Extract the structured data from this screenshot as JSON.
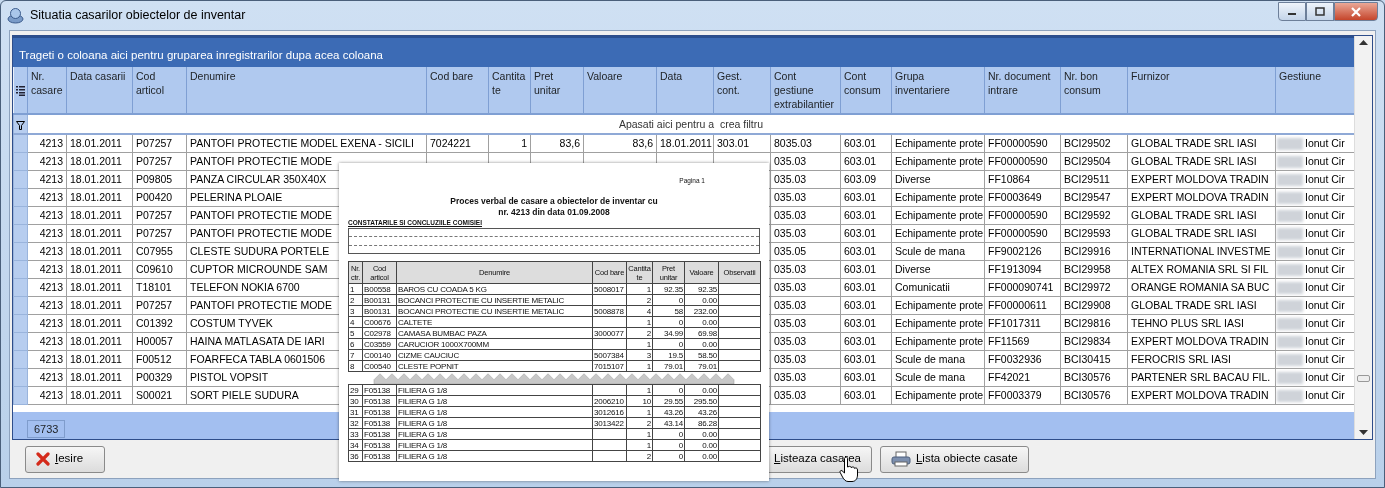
{
  "window": {
    "title": "Situatia casarilor obiectelor de inventar"
  },
  "grid": {
    "group_panel": "Trageti o coloana aici pentru gruparea inregistrarilor dupa acea coloana",
    "columns": [
      "Nr. casare",
      "Data casarii",
      "Cod articol",
      "Denumire",
      "Cod bare",
      "Cantitate",
      "Pret unitar",
      "Valoare",
      "Data",
      "Gest. cont.",
      "Cont gestiune extrabilantier",
      "Cont consum",
      "Grupa inventariere",
      "Nr. document intrare",
      "Nr. bon consum",
      "Furnizor",
      "Gestiune"
    ],
    "filter_row": "Apasati aici pentru a  crea filtru",
    "rows": [
      {
        "nr_casare": "4213",
        "data_casarii": "18.01.2011",
        "cod_articol": "P07257",
        "denumire": "PANTOFI PROTECTIE MODEL EXENA - SICILI",
        "cod_bare": "7024221",
        "cantitate": "1",
        "pret_unitar": "83,6",
        "valoare": "83,6",
        "data": "18.01.2011",
        "gest_cont": "303.01",
        "cont_gestiune": "8035.03",
        "cont_consum": "603.01",
        "grupa_inventariere": "Echipamente prote",
        "nr_document_intrare": "FF00000590",
        "nr_bon_consum": "BCI29502",
        "furnizor": "GLOBAL TRADE SRL IASI",
        "gestiune": "Ionut Cir"
      },
      {
        "nr_casare": "4213",
        "data_casarii": "18.01.2011",
        "cod_articol": "P07257",
        "denumire": "PANTOFI PROTECTIE MODE",
        "cont_gestiune": "035.03",
        "cont_consum": "603.01",
        "grupa_inventariere": "Echipamente prote",
        "nr_document_intrare": "FF00000590",
        "nr_bon_consum": "BCI29504",
        "furnizor": "GLOBAL TRADE SRL IASI",
        "gestiune": "Ionut Cir"
      },
      {
        "nr_casare": "4213",
        "data_casarii": "18.01.2011",
        "cod_articol": "P09805",
        "denumire": "PANZA CIRCULAR 350X40X",
        "cont_gestiune": "035.03",
        "cont_consum": "603.09",
        "grupa_inventariere": "Diverse",
        "nr_document_intrare": "FF10864",
        "nr_bon_consum": "BCI29511",
        "furnizor": "EXPERT MOLDOVA TRADIN",
        "gestiune": "Ionut Cir"
      },
      {
        "nr_casare": "4213",
        "data_casarii": "18.01.2011",
        "cod_articol": "P00420",
        "denumire": "PELERINA PLOAIE",
        "cont_gestiune": "035.03",
        "cont_consum": "603.01",
        "grupa_inventariere": "Echipamente prote",
        "nr_document_intrare": "FF0003649",
        "nr_bon_consum": "BCI29547",
        "furnizor": "EXPERT MOLDOVA TRADIN",
        "gestiune": "Ionut Cir"
      },
      {
        "nr_casare": "4213",
        "data_casarii": "18.01.2011",
        "cod_articol": "P07257",
        "denumire": "PANTOFI PROTECTIE MODE",
        "cont_gestiune": "035.03",
        "cont_consum": "603.01",
        "grupa_inventariere": "Echipamente prote",
        "nr_document_intrare": "FF00000590",
        "nr_bon_consum": "BCI29592",
        "furnizor": "GLOBAL TRADE SRL IASI",
        "gestiune": "Ionut Cir"
      },
      {
        "nr_casare": "4213",
        "data_casarii": "18.01.2011",
        "cod_articol": "P07257",
        "denumire": "PANTOFI PROTECTIE MODE",
        "cont_gestiune": "035.03",
        "cont_consum": "603.01",
        "grupa_inventariere": "Echipamente prote",
        "nr_document_intrare": "FF00000590",
        "nr_bon_consum": "BCI29593",
        "furnizor": "GLOBAL TRADE SRL IASI",
        "gestiune": "Ionut Cir"
      },
      {
        "nr_casare": "4213",
        "data_casarii": "18.01.2011",
        "cod_articol": "C07955",
        "denumire": "CLESTE SUDURA PORTELE",
        "cont_gestiune": "035.05",
        "cont_consum": "603.01",
        "grupa_inventariere": "Scule de mana",
        "nr_document_intrare": "FF9002126",
        "nr_bon_consum": "BCI29916",
        "furnizor": "INTERNATIONAL INVESTME",
        "gestiune": "Ionut Cir"
      },
      {
        "nr_casare": "4213",
        "data_casarii": "18.01.2011",
        "cod_articol": "C09610",
        "denumire": "CUPTOR MICROUNDE SAM",
        "cont_gestiune": "035.03",
        "cont_consum": "603.01",
        "grupa_inventariere": "Diverse",
        "nr_document_intrare": "FF1913094",
        "nr_bon_consum": "BCI29958",
        "furnizor": "ALTEX ROMANIA SRL SI FIL",
        "gestiune": "Ionut Cir"
      },
      {
        "nr_casare": "4213",
        "data_casarii": "18.01.2011",
        "cod_articol": "T18101",
        "denumire": "TELEFON NOKIA 6700",
        "cont_gestiune": "035.03",
        "cont_consum": "603.01",
        "grupa_inventariere": "Comunicatii",
        "nr_document_intrare": "FF000090741",
        "nr_bon_consum": "BCI29972",
        "furnizor": "ORANGE ROMANIA SA BUC",
        "gestiune": "Ionut Cir"
      },
      {
        "nr_casare": "4213",
        "data_casarii": "18.01.2011",
        "cod_articol": "P07257",
        "denumire": "PANTOFI PROTECTIE MODE",
        "cont_gestiune": "035.03",
        "cont_consum": "603.01",
        "grupa_inventariere": "Echipamente prote",
        "nr_document_intrare": "FF00000611",
        "nr_bon_consum": "BCI29908",
        "furnizor": "GLOBAL TRADE SRL IASI",
        "gestiune": "Ionut Cir"
      },
      {
        "nr_casare": "4213",
        "data_casarii": "18.01.2011",
        "cod_articol": "C01392",
        "denumire": "COSTUM TYVEK",
        "cont_gestiune": "035.03",
        "cont_consum": "603.01",
        "grupa_inventariere": "Echipamente prote",
        "nr_document_intrare": "FF1017311",
        "nr_bon_consum": "BCI29816",
        "furnizor": "TEHNO PLUS SRL IASI",
        "gestiune": "Ionut Cir"
      },
      {
        "nr_casare": "4213",
        "data_casarii": "18.01.2011",
        "cod_articol": "H00057",
        "denumire": "HAINA MATLASATA DE IARI",
        "cont_gestiune": "035.03",
        "cont_consum": "603.01",
        "grupa_inventariere": "Echipamente prote",
        "nr_document_intrare": "FF11569",
        "nr_bon_consum": "BCI29834",
        "furnizor": "EXPERT MOLDOVA TRADIN",
        "gestiune": "Ionut Cir"
      },
      {
        "nr_casare": "4213",
        "data_casarii": "18.01.2011",
        "cod_articol": "F00512",
        "denumire": "FOARFECA TABLA  0601506",
        "cont_gestiune": "035.03",
        "cont_consum": "603.01",
        "grupa_inventariere": "Scule de mana",
        "nr_document_intrare": "FF0032936",
        "nr_bon_consum": "BCI30415",
        "furnizor": "FEROCRIS SRL IASI",
        "gestiune": "Ionut Cir"
      },
      {
        "nr_casare": "4213",
        "data_casarii": "18.01.2011",
        "cod_articol": "P00329",
        "denumire": "PISTOL VOPSIT",
        "cont_gestiune": "035.03",
        "cont_consum": "603.01",
        "grupa_inventariere": "Scule de mana",
        "nr_document_intrare": "FF42021",
        "nr_bon_consum": "BCI30576",
        "furnizor": "PARTENER SRL BACAU FIL.",
        "gestiune": "Ionut Cir"
      },
      {
        "nr_casare": "4213",
        "data_casarii": "18.01.2011",
        "cod_articol": "S00021",
        "denumire": "SORT PIELE SUDURA",
        "cont_gestiune": "035.03",
        "cont_consum": "603.01",
        "grupa_inventariere": "Echipamente prote",
        "nr_document_intrare": "FF0003379",
        "nr_bon_consum": "BCI30576",
        "furnizor": "EXPERT MOLDOVA TRADIN",
        "gestiune": "Ionut Cir"
      }
    ],
    "footer_count": "6733"
  },
  "report": {
    "page": "Pagina 1",
    "title_lines": [
      "Proces verbal de casare a obiectelor de inventar cu",
      "nr. 4213 din data 01.09.2008"
    ],
    "section": "CONSTATARILE SI CONCLUZIILE COMISIEI",
    "columns": [
      "Nr. ctr.",
      "Cod articol",
      "Denumire",
      "Cod bare",
      "Cantitate",
      "Pret unitar",
      "Valoare",
      "Observatii"
    ],
    "rows_before_tear": [
      {
        "nr": "1",
        "cod_articol": "B00558",
        "denumire": "BAROS CU COADA 5 KG",
        "cod_bare": "5008017",
        "cantitate": "1",
        "pret_unitar": "92.35",
        "valoare": "92.35"
      },
      {
        "nr": "2",
        "cod_articol": "B00131",
        "denumire": "BOCANCI PROTECTIE CU INSERTIE METALIC",
        "cantitate": "2",
        "pret_unitar": "0",
        "valoare": "0.00"
      },
      {
        "nr": "3",
        "cod_articol": "B00131",
        "denumire": "BOCANCI PROTECTIE CU INSERTIE METALIC",
        "cod_bare": "5008878",
        "cantitate": "4",
        "pret_unitar": "58",
        "valoare": "232.00"
      },
      {
        "nr": "4",
        "cod_articol": "C00676",
        "denumire": "CALTETE",
        "cantitate": "1",
        "pret_unitar": "0",
        "valoare": "0.00"
      },
      {
        "nr": "5",
        "cod_articol": "C02978",
        "denumire": "CAMASA BUMBAC PAZA",
        "cod_bare": "3000077",
        "cantitate": "2",
        "pret_unitar": "34.99",
        "valoare": "69.98"
      },
      {
        "nr": "6",
        "cod_articol": "C03559",
        "denumire": "CARUCIOR 1000X700MM",
        "cantitate": "1",
        "pret_unitar": "0",
        "valoare": "0.00"
      },
      {
        "nr": "7",
        "cod_articol": "C00140",
        "denumire": "CIZME CAUCIUC",
        "cod_bare": "5007384",
        "cantitate": "3",
        "pret_unitar": "19.5",
        "valoare": "58.50"
      },
      {
        "nr": "8",
        "cod_articol": "C00540",
        "denumire": "CLESTE POPNIT",
        "cod_bare": "7015107",
        "cantitate": "1",
        "pret_unitar": "79.01",
        "valoare": "79.01"
      }
    ],
    "rows_after_tear": [
      {
        "nr": "29",
        "cod_articol": "F05138",
        "denumire": "FILIERA G 1/8",
        "cantitate": "1",
        "pret_unitar": "0",
        "valoare": "0.00"
      },
      {
        "nr": "30",
        "cod_articol": "F05138",
        "denumire": "FILIERA G 1/8",
        "cod_bare": "2006210",
        "cantitate": "10",
        "pret_unitar": "29.55",
        "valoare": "295.50"
      },
      {
        "nr": "31",
        "cod_articol": "F05138",
        "denumire": "FILIERA G 1/8",
        "cod_bare": "3012616",
        "cantitate": "1",
        "pret_unitar": "43.26",
        "valoare": "43.26"
      },
      {
        "nr": "32",
        "cod_articol": "F05138",
        "denumire": "FILIERA G 1/8",
        "cod_bare": "3013422",
        "cantitate": "2",
        "pret_unitar": "43.14",
        "valoare": "86.28"
      },
      {
        "nr": "33",
        "cod_articol": "F05138",
        "denumire": "FILIERA G 1/8",
        "cantitate": "1",
        "pret_unitar": "0",
        "valoare": "0.00"
      },
      {
        "nr": "34",
        "cod_articol": "F05138",
        "denumire": "FILIERA G 1/8",
        "cantitate": "1",
        "pret_unitar": "0",
        "valoare": "0.00"
      },
      {
        "nr": "36",
        "cod_articol": "F05138",
        "denumire": "FILIERA G 1/8",
        "cantitate": "2",
        "pret_unitar": "0",
        "valoare": "0.00"
      }
    ]
  },
  "buttons": [
    {
      "label": "Iesire",
      "kind": "exit"
    },
    {
      "label": "Listeaza casarea",
      "kind": "list"
    },
    {
      "label": "Lista obiecte casate",
      "kind": "print"
    }
  ]
}
